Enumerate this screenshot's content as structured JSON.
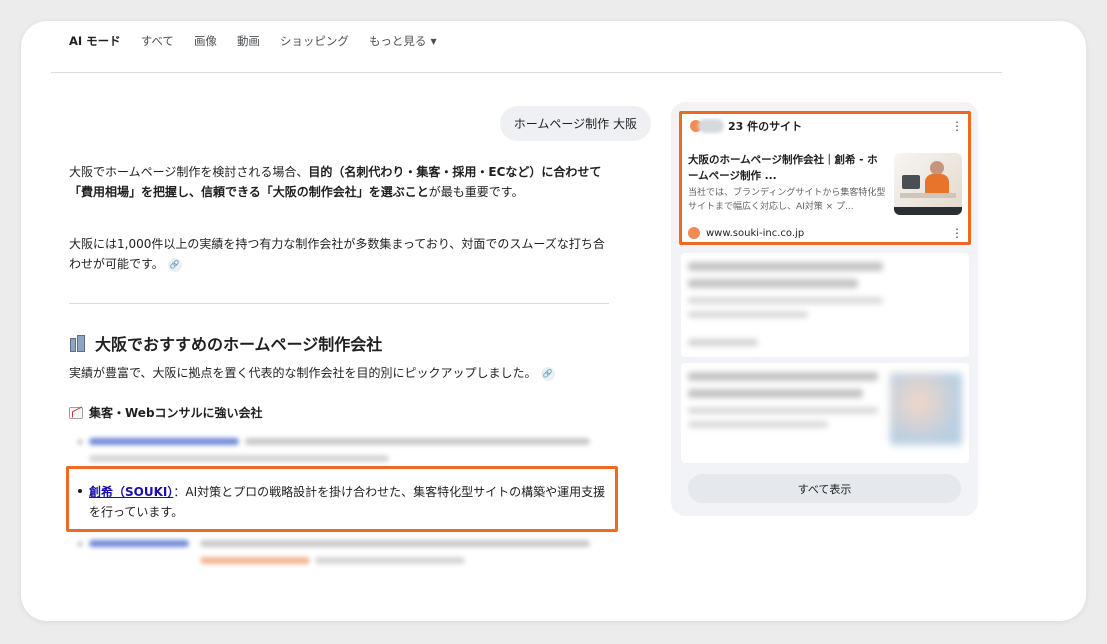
{
  "tabs": {
    "items": [
      {
        "label": "AI モード"
      },
      {
        "label": "すべて"
      },
      {
        "label": "画像"
      },
      {
        "label": "動画"
      },
      {
        "label": "ショッピング"
      },
      {
        "label": "もっと見る"
      }
    ]
  },
  "query": "ホームページ制作 大阪",
  "answer": {
    "p1_part1": "大阪でホームページ制作を検討される場合、",
    "p1_bold": "目的（名刺代わり・集客・採用・ECなど）に合わせて「費用相場」を把握し、信頼できる「大阪の制作会社」を選ぶこと",
    "p1_part2": "が最も重要です。",
    "p2": "大阪には1,000件以上の実績を持つ有力な制作会社が多数集まっており、対面でのスムーズな打ち合わせが可能です。",
    "section_title": "大阪でおすすめのホームページ制作会社",
    "section_sub": "実績が豊富で、大阪に拠点を置く代表的な制作会社を目的別にピックアップしました。",
    "subsection_title": "集客・Webコンサルに強い会社",
    "bullet_link": "創希（SOUKI）",
    "bullet_text": "：AI対策とプロの戦略設計を掛け合わせた、集客特化型サイトの構築や運用支援を行っています。"
  },
  "sources_panel": {
    "count_label": "23 件のサイト",
    "result_title": "大阪のホームページ制作会社｜創希 - ホームページ制作 ...",
    "result_snippet": "当社では、ブランディングサイトから集客特化型サイトまで幅広く対応し、AI対策 × プ...",
    "result_domain": "www.souki-inc.co.jp",
    "show_all_label": "すべて表示"
  },
  "colors": {
    "highlight": "#ef6a1f",
    "link": "#1a0dab"
  }
}
